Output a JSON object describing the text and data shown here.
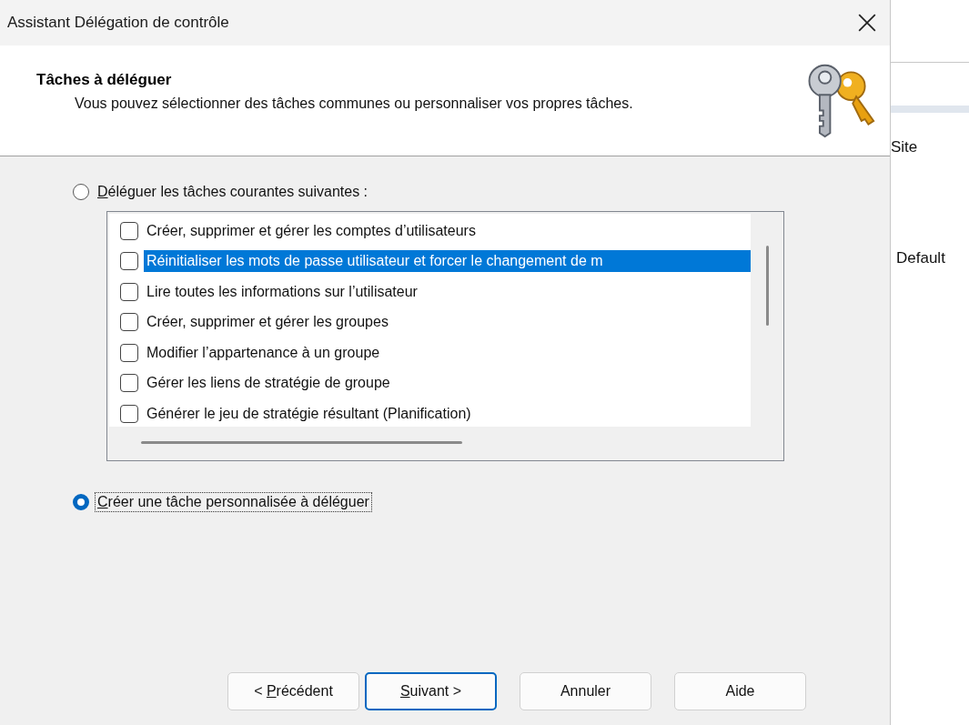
{
  "window": {
    "title": "Assistant Délégation de contrôle"
  },
  "header": {
    "title": "Tâches à déléguer",
    "description": "Vous pouvez sélectionner des tâches communes ou personnaliser vos propres tâches."
  },
  "options": [
    {
      "label": "Déléguer les tâches courantes suivantes :",
      "selected": false,
      "underline_first": true,
      "kind": "list"
    },
    {
      "label": "Créer une tâche personnalisée à déléguer",
      "selected": true,
      "underline_first": true,
      "kind": "plain"
    }
  ],
  "tasks": [
    {
      "label": "Créer, supprimer et gérer les comptes d’utilisateurs",
      "checked": false,
      "selected": false
    },
    {
      "label": "Réinitialiser les mots de passe utilisateur et forcer le changement de m",
      "checked": false,
      "selected": true
    },
    {
      "label": "Lire toutes les informations sur l’utilisateur",
      "checked": false,
      "selected": false
    },
    {
      "label": "Créer, supprimer et gérer les groupes",
      "checked": false,
      "selected": false
    },
    {
      "label": "Modifier l’appartenance à un groupe",
      "checked": false,
      "selected": false
    },
    {
      "label": "Gérer les liens de stratégie de groupe",
      "checked": false,
      "selected": false
    },
    {
      "label": "Générer le jeu de stratégie résultant (Planification)",
      "checked": false,
      "selected": false
    }
  ],
  "buttons": [
    {
      "label": "< Précédent",
      "underline_mnemonic": true,
      "default": false
    },
    {
      "label": "Suivant >",
      "underline_mnemonic": true,
      "default": true
    },
    {
      "label": "Annuler",
      "default": false
    },
    {
      "label": "Aide",
      "default": false
    }
  ],
  "background_window": {
    "labels": [
      "Site",
      "Default"
    ]
  }
}
